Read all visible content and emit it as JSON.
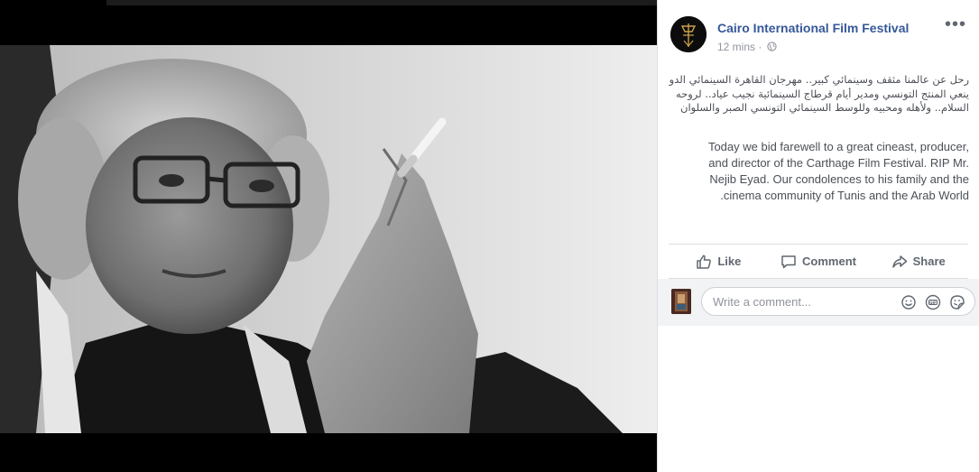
{
  "post": {
    "page_name": "Cairo International Film Festival",
    "time": "12 mins",
    "separator": "·",
    "arabic_lines": [
      "رحل عن عالمنا مثقف وسينمائي كبير.. مهرجان القاهرة السينمائي الدولي",
      "ينعي المنتج التونسي ومدير أيام قرطاج السينمائية نجيب عياد.. لروحه",
      "السلام.. ولأهله ومحبيه وللوسط السينمائي التونسي الصبر والسلوان"
    ],
    "english_lines": [
      "Today we bid farewell to a great cineast, producer,",
      "and director of the Carthage Film Festival. RIP Mr.",
      "Nejib Eyad. Our condolences to his family and the",
      ".cinema community of Tunis and the Arab World"
    ]
  },
  "actions": {
    "like": "Like",
    "comment": "Comment",
    "share": "Share"
  },
  "comment_box": {
    "placeholder": "Write a comment..."
  },
  "icons": {
    "more": "more-options-icon",
    "privacy": "globe-icon",
    "like": "thumbs-up-icon",
    "comment": "speech-bubble-icon",
    "share": "share-arrow-icon",
    "emoji": "smiley-icon",
    "gif": "gif-icon",
    "sticker": "sticker-icon"
  },
  "colors": {
    "page_name": "#365899",
    "meta": "#90949c",
    "action_text": "#606770",
    "body_text": "#4b4f56"
  }
}
